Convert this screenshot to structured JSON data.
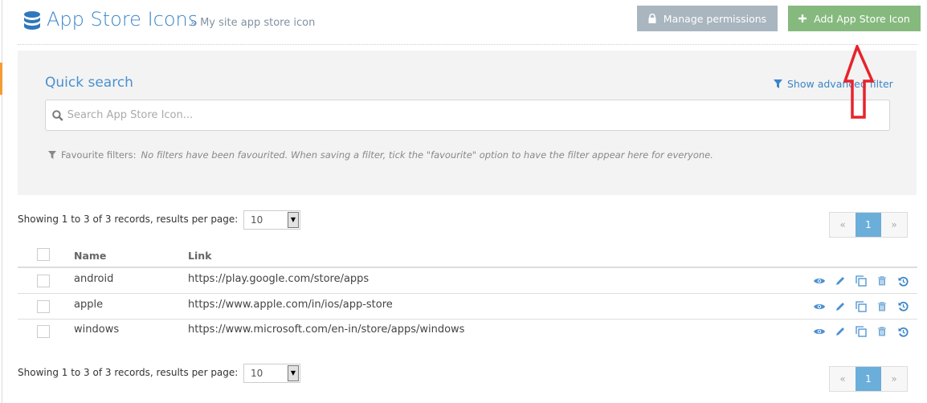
{
  "header": {
    "title": "App Store Icons",
    "breadcrumb": "» My site app store icon",
    "icon": "database-icon"
  },
  "buttons": {
    "manage_permissions": "Manage permissions",
    "add": "Add App Store Icon"
  },
  "quick_search": {
    "title": "Quick search",
    "advanced_filter": "Show advanced filter",
    "placeholder": "Search App Store Icon...",
    "fav_label": "Favourite filters:",
    "fav_text": "No filters have been favourited. When saving a filter, tick the \"favourite\" option to have the filter appear here for everyone."
  },
  "paging": {
    "showing": "Showing 1 to 3 of 3 records,  results per page:",
    "per_page": "10",
    "prev": "«",
    "page": "1",
    "next": "»"
  },
  "table": {
    "columns": [
      "Name",
      "Link"
    ],
    "rows": [
      {
        "name": "android",
        "link": "https://play.google.com/store/apps"
      },
      {
        "name": "apple",
        "link": "https://www.apple.com/in/ios/app-store"
      },
      {
        "name": "windows",
        "link": "https://www.microsoft.com/en-in/store/apps/windows"
      }
    ],
    "row_actions": [
      "view-icon",
      "edit-icon",
      "copy-icon",
      "delete-icon",
      "history-icon"
    ]
  },
  "colors": {
    "accent": "#3a85c8",
    "add_button": "#86b97e",
    "permissions_button": "#a9b5bf",
    "annotation": "#e8232a"
  }
}
